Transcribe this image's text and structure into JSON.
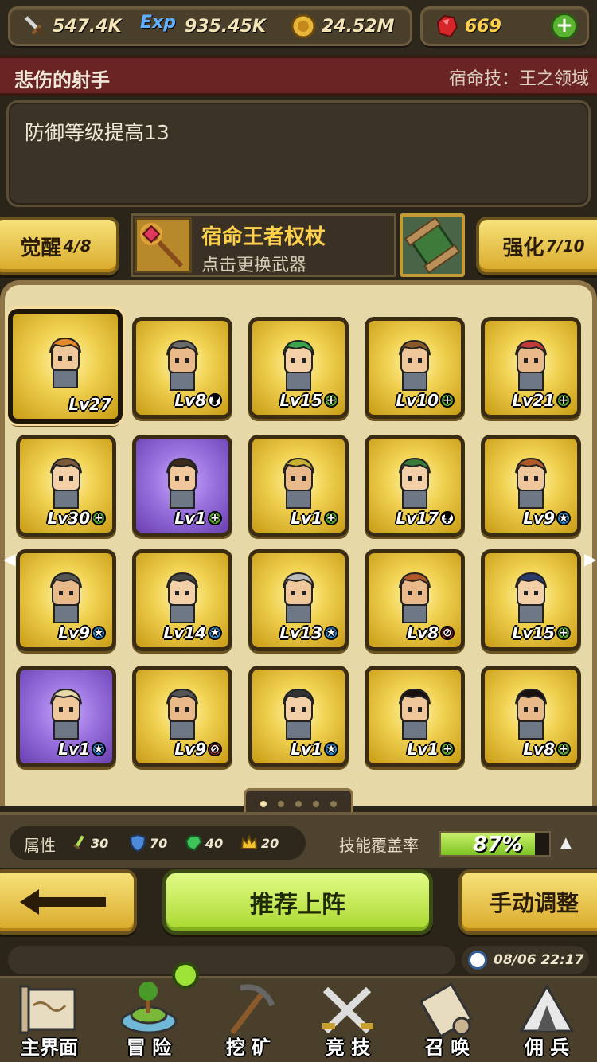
{
  "resources": {
    "attack": "547.4K",
    "exp": "935.45K",
    "gold": "24.52M",
    "gems": "669",
    "exp_icon_text": "Exp"
  },
  "title": {
    "hero_name": "悲伤的射手",
    "destiny_skill": "宿命技：王之领域"
  },
  "description": "防御等级提高13",
  "weapon": {
    "awaken_label": "觉醒",
    "awaken_value": "4/8",
    "name": "宿命王者权杖",
    "hint": "点击更换武器",
    "enhance_label": "强化",
    "enhance_value": "7/10"
  },
  "heroes": [
    {
      "lv": "Lv27",
      "status": "",
      "frame": "gold",
      "selected": true
    },
    {
      "lv": "Lv8",
      "status": "?",
      "frame": "gold"
    },
    {
      "lv": "Lv15",
      "status": "+",
      "frame": "gold"
    },
    {
      "lv": "Lv10",
      "status": "+",
      "frame": "gold"
    },
    {
      "lv": "Lv21",
      "status": "+",
      "frame": "gold"
    },
    {
      "lv": "Lv30",
      "status": "+",
      "frame": "gold"
    },
    {
      "lv": "Lv1",
      "status": "+",
      "frame": "purple"
    },
    {
      "lv": "Lv1",
      "status": "+",
      "frame": "gold"
    },
    {
      "lv": "Lv17",
      "status": "?",
      "frame": "gold"
    },
    {
      "lv": "Lv9",
      "status": "★",
      "frame": "gold"
    },
    {
      "lv": "Lv9",
      "status": "★",
      "frame": "gold"
    },
    {
      "lv": "Lv14",
      "status": "★",
      "frame": "gold"
    },
    {
      "lv": "Lv13",
      "status": "★",
      "frame": "gold"
    },
    {
      "lv": "Lv8",
      "status": "⊘",
      "frame": "gold"
    },
    {
      "lv": "Lv15",
      "status": "+",
      "frame": "gold"
    },
    {
      "lv": "Lv1",
      "status": "★",
      "frame": "purple"
    },
    {
      "lv": "Lv9",
      "status": "⊘",
      "frame": "gold"
    },
    {
      "lv": "Lv1",
      "status": "★",
      "frame": "gold"
    },
    {
      "lv": "Lv1",
      "status": "+",
      "frame": "gold"
    },
    {
      "lv": "Lv8",
      "status": "+",
      "frame": "gold"
    }
  ],
  "attributes": {
    "label": "属性",
    "sword": "30",
    "shield": "70",
    "gem": "40",
    "crown": "20"
  },
  "coverage": {
    "label": "技能覆盖率",
    "value": "87%",
    "fraction": 0.87
  },
  "actions": {
    "recommend": "推荐上阵",
    "manual": "手动调整"
  },
  "time": "08/06 22:17",
  "nav": [
    {
      "label": "主界面",
      "icon": "map-scroll-icon"
    },
    {
      "label": "冒 险",
      "icon": "island-icon"
    },
    {
      "label": "挖 矿",
      "icon": "pickaxe-icon"
    },
    {
      "label": "竞 技",
      "icon": "crossed-swords-icon"
    },
    {
      "label": "召 唤",
      "icon": "scroll-icon"
    },
    {
      "label": "佣 兵",
      "icon": "tent-icon"
    }
  ],
  "colors": {
    "title_bar": "#6b2424",
    "accent_gold": "#ffd04a",
    "recommend_green": "#a9d82f"
  }
}
